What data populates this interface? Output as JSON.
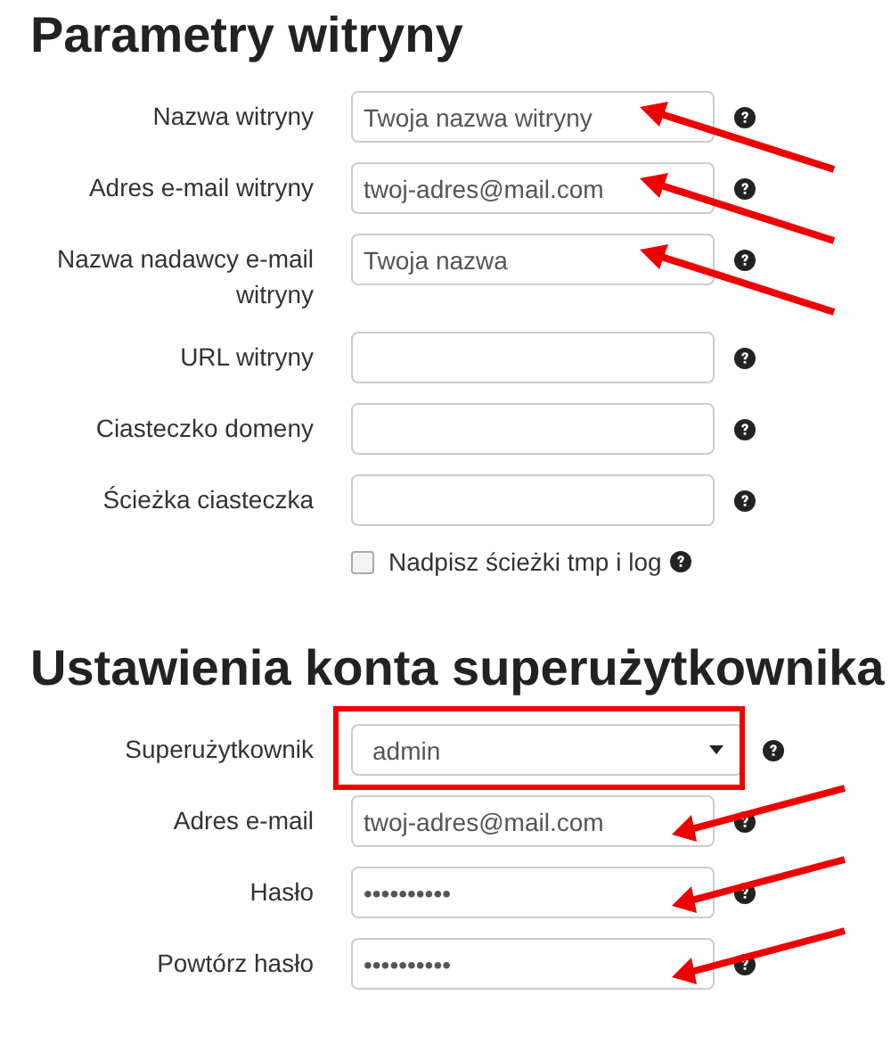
{
  "sections": [
    {
      "heading": "Parametry witryny",
      "rows": [
        {
          "kind": "text",
          "label": "Nazwa witryny",
          "value": "Twoja nazwa witryny",
          "arrow": true
        },
        {
          "kind": "text",
          "label": "Adres e-mail witryny",
          "value": "twoj-adres@mail.com",
          "arrow": true
        },
        {
          "kind": "text",
          "label": "Nazwa nadawcy e-mail witryny",
          "value": "Twoja nazwa",
          "arrow": true
        },
        {
          "kind": "text",
          "label": "URL witryny",
          "value": "",
          "arrow": false
        },
        {
          "kind": "text",
          "label": "Ciasteczko domeny",
          "value": "",
          "arrow": false
        },
        {
          "kind": "text",
          "label": "Ścieżka ciasteczka",
          "value": "",
          "arrow": false
        },
        {
          "kind": "checkbox",
          "label": "Nadpisz ścieżki tmp i log",
          "checked": false
        }
      ]
    },
    {
      "heading": "Ustawienia konta superużytkownika",
      "rows": [
        {
          "kind": "select",
          "label": "Superużytkownik",
          "value": "admin",
          "highlighted": true
        },
        {
          "kind": "text",
          "label": "Adres e-mail",
          "value": "twoj-adres@mail.com",
          "arrow": true
        },
        {
          "kind": "text",
          "label": "Hasło",
          "value": "••••••••••",
          "arrow": true
        },
        {
          "kind": "text",
          "label": "Powtórz hasło",
          "value": "••••••••••",
          "arrow": true
        }
      ]
    }
  ]
}
